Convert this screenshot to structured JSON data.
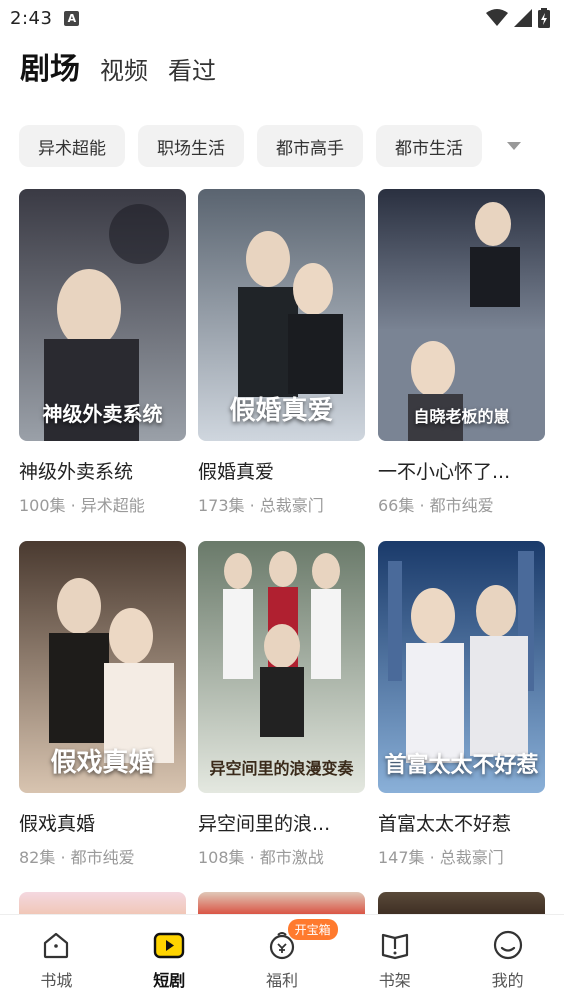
{
  "status_bar": {
    "time": "2:43",
    "notification_icon": "A"
  },
  "top_tabs": [
    {
      "label": "剧场",
      "active": true
    },
    {
      "label": "视频",
      "active": false
    },
    {
      "label": "看过",
      "active": false
    }
  ],
  "chips": [
    "异术超能",
    "职场生活",
    "都市高手",
    "都市生活"
  ],
  "dramas": [
    {
      "title": "神级外卖系统",
      "episodes": "100集",
      "genre": "异术超能",
      "meta": "100集 · 异术超能",
      "cover_text": "神级外卖系统",
      "colors": [
        "#3a3a44",
        "#9aa0a8"
      ]
    },
    {
      "title": "假婚真爱",
      "episodes": "173集",
      "genre": "总裁豪门",
      "meta": "173集 · 总裁豪门",
      "cover_text": "假婚真爱",
      "colors": [
        "#5a6470",
        "#cfd6de"
      ]
    },
    {
      "title": "一不小心怀了...",
      "episodes": "66集",
      "genre": "都市纯爱",
      "meta": "66集 · 都市纯爱",
      "cover_text": "自晓老板的崽",
      "colors": [
        "#2a3040",
        "#b8c4d4"
      ]
    },
    {
      "title": "假戏真婚",
      "episodes": "82集",
      "genre": "都市纯爱",
      "meta": "82集 · 都市纯爱",
      "cover_text": "假戏真婚",
      "colors": [
        "#4a3a30",
        "#d8c4b0"
      ]
    },
    {
      "title": "异空间里的浪...",
      "episodes": "108集",
      "genre": "都市激战",
      "meta": "108集 · 都市激战",
      "cover_text": "异空间里的浪漫变奏",
      "colors": [
        "#6a7a6a",
        "#e4e8e0"
      ]
    },
    {
      "title": "首富太太不好惹",
      "episodes": "147集",
      "genre": "总裁豪门",
      "meta": "147集 · 总裁豪门",
      "cover_text": "首富太太不好惹",
      "colors": [
        "#1a3a6a",
        "#8ab0d8"
      ]
    }
  ],
  "bottom_nav": [
    {
      "label": "书城",
      "icon": "home-icon",
      "active": false
    },
    {
      "label": "短剧",
      "icon": "play-icon",
      "active": true
    },
    {
      "label": "福利",
      "icon": "gift-icon",
      "active": false,
      "badge": "开宝箱"
    },
    {
      "label": "书架",
      "icon": "bookshelf-icon",
      "active": false
    },
    {
      "label": "我的",
      "icon": "profile-icon",
      "active": false
    }
  ],
  "colors": {
    "badge": "#ff7a2e",
    "chip_bg": "#f2f2f2",
    "meta_text": "#9a9a9a"
  }
}
